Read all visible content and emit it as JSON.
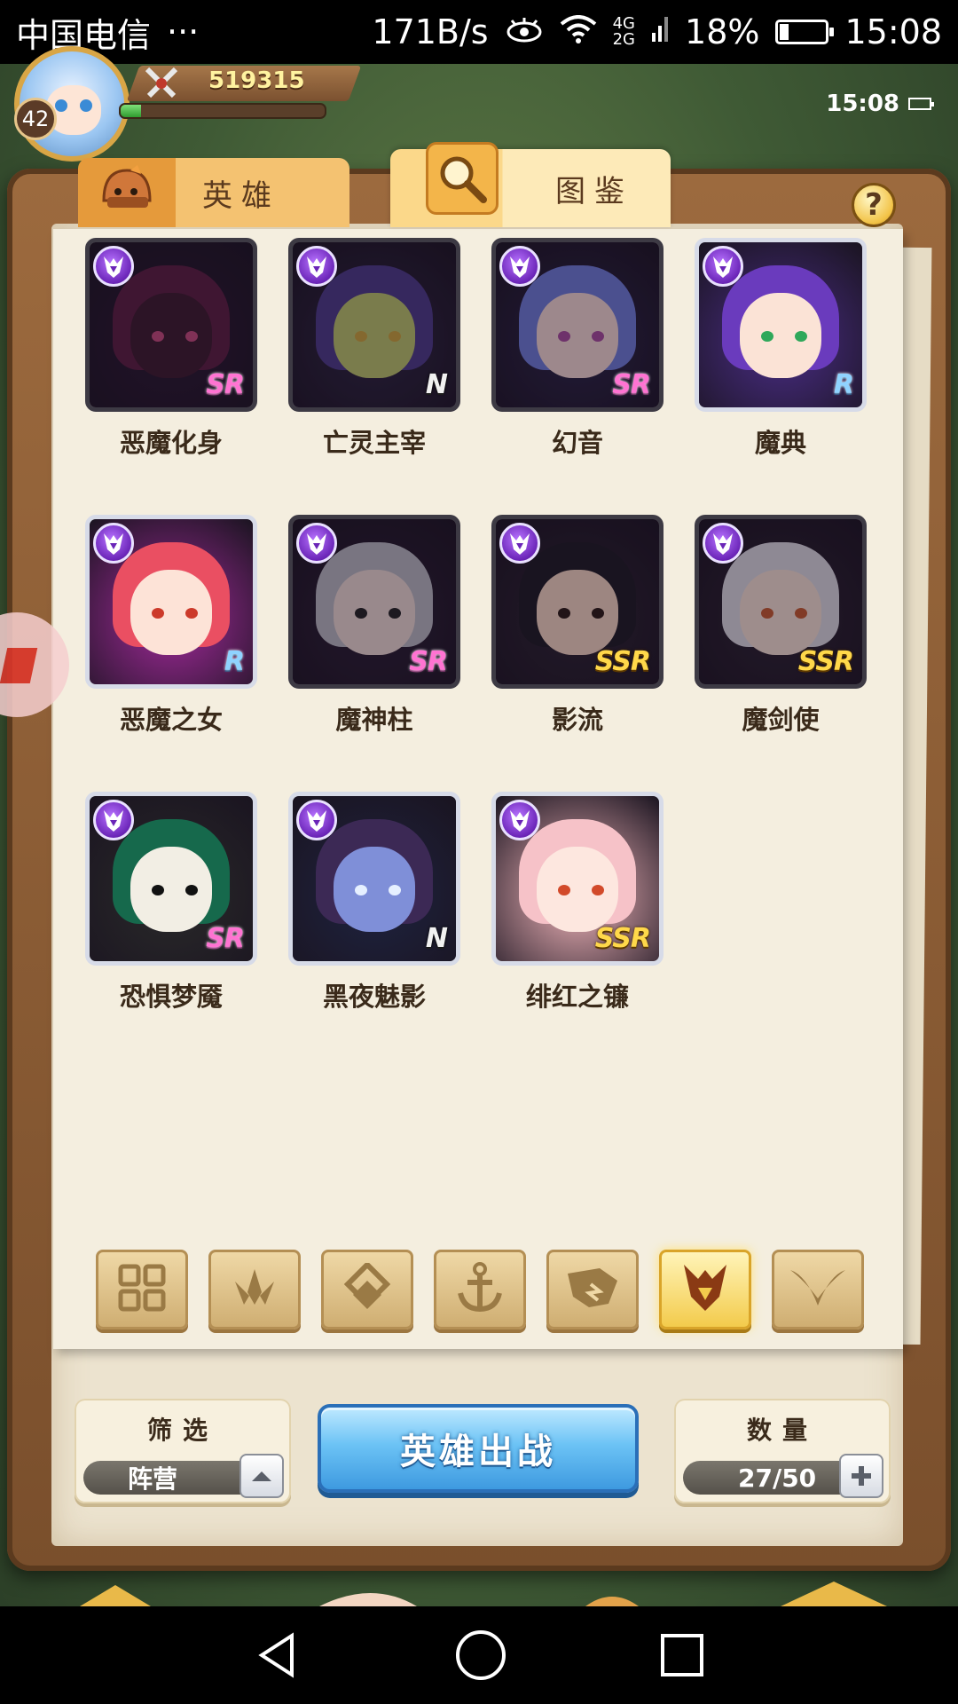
{
  "status_bar": {
    "carrier": "中国电信",
    "more": "···",
    "net_speed": "171B/s",
    "net_type_top": "4G",
    "net_type_bottom": "2G",
    "battery_percent": "18%",
    "battery_level": 0.18,
    "time": "15:08"
  },
  "hud": {
    "player_level": "42",
    "power": "519315",
    "exp_fraction": 0.1,
    "game_time": "15:08"
  },
  "tabs": [
    {
      "label": "英雄",
      "icon": "knight-helmet-icon",
      "active": false
    },
    {
      "label": "图鉴",
      "icon": "magnifier-icon",
      "active": true
    }
  ],
  "help_label": "?",
  "heroes": [
    {
      "name": "恶魔化身",
      "rarity": "SR",
      "dim": true,
      "hair": "#5a1d3f",
      "skin": "#3b1a2c",
      "eye": "#c24a7a",
      "bg": "#2a1830"
    },
    {
      "name": "亡灵主宰",
      "rarity": "N",
      "dim": true,
      "hair": "#4b3a86",
      "skin": "#b9c26a",
      "eye": "#c9a23a",
      "bg": "#2c2540"
    },
    {
      "name": "幻音",
      "rarity": "SR",
      "dim": true,
      "hair": "#6d7bd6",
      "skin": "#f1d6d0",
      "eye": "#a54b9c",
      "bg": "#2a2446"
    },
    {
      "name": "魔典",
      "rarity": "R",
      "dim": false,
      "hair": "#6a3bbd",
      "skin": "#fbe3d6",
      "eye": "#2fa85a",
      "bg": "#4a2d86"
    },
    {
      "name": "恶魔之女",
      "rarity": "R",
      "dim": false,
      "hair": "#ea4f62",
      "skin": "#fde3d7",
      "eye": "#cc3a2a",
      "bg": "#a42a9c"
    },
    {
      "name": "魔神柱",
      "rarity": "SR",
      "dim": true,
      "hair": "#b7b7bf",
      "skin": "#ead7d0",
      "eye": "#222222",
      "bg": "#2b1f33"
    },
    {
      "name": "影流",
      "rarity": "SSR",
      "dim": true,
      "hair": "#1c1a22",
      "skin": "#f0d2be",
      "eye": "#2a1a14",
      "bg": "#2c2430"
    },
    {
      "name": "魔剑使",
      "rarity": "SSR",
      "dim": true,
      "hair": "#d9d7dd",
      "skin": "#f3ddd1",
      "eye": "#c45a2e",
      "bg": "#2c2330"
    },
    {
      "name": "恐惧梦魇",
      "rarity": "SR",
      "dim": false,
      "hair": "#16694c",
      "skin": "#f2eee4",
      "eye": "#111111",
      "bg": "#2a2a2a"
    },
    {
      "name": "黑夜魅影",
      "rarity": "N",
      "dim": false,
      "hair": "#3c2955",
      "skin": "#7f8fd8",
      "eye": "#e6f0ff",
      "bg": "#1e2340"
    },
    {
      "name": "绯红之镰",
      "rarity": "SSR",
      "dim": false,
      "hair": "#f6c2c8",
      "skin": "#fde7df",
      "eye": "#d24a2a",
      "bg": "#f5b8bd"
    }
  ],
  "faction_filters": [
    {
      "icon": "all-grid-icon",
      "active": false
    },
    {
      "icon": "forest-faction-icon",
      "active": false
    },
    {
      "icon": "holy-faction-icon",
      "active": false
    },
    {
      "icon": "anchor-faction-icon",
      "active": false
    },
    {
      "icon": "beast-faction-icon",
      "active": false
    },
    {
      "icon": "demon-faction-icon",
      "active": true
    },
    {
      "icon": "light-faction-icon",
      "active": false
    }
  ],
  "filter": {
    "title": "筛选",
    "value": "阵营",
    "button_icon": "chevron-up-icon"
  },
  "deploy_label": "英雄出战",
  "count": {
    "title": "数量",
    "value": "27/50",
    "button_icon": "plus-icon"
  }
}
